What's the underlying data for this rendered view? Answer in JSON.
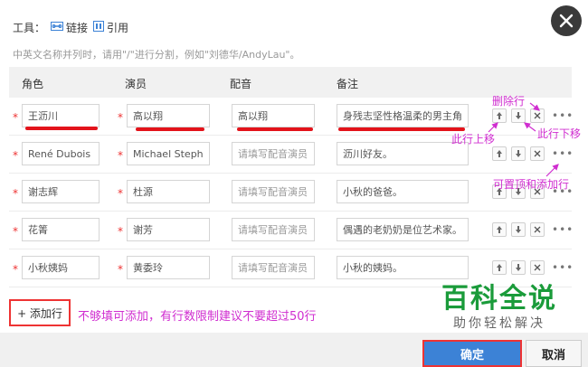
{
  "toolbar": {
    "label": "工具：",
    "link_label": "链接",
    "quote_label": "引用"
  },
  "hint": "中英文名称并列时，请用\"/\"进行分割，例如\"刘德华/AndyLau\"。",
  "table": {
    "headers": [
      "角色",
      "演员",
      "配音",
      "备注"
    ],
    "required_mark": "*",
    "rows": [
      {
        "role": "王沥川",
        "actor": "高以翔",
        "voice": "高以翔",
        "note": "身残志坚性格温柔的男主角。"
      },
      {
        "role": "René Dubois",
        "actor": "Michael Stephen",
        "voice": "",
        "note": "沥川好友。"
      },
      {
        "role": "谢志辉",
        "actor": "杜源",
        "voice": "",
        "note": "小秋的爸爸。"
      },
      {
        "role": "花箐",
        "actor": "谢芳",
        "voice": "",
        "note": "偶遇的老奶奶是位艺术家。"
      },
      {
        "role": "小秋姨妈",
        "actor": "黄委玲",
        "voice": "",
        "note": "小秋的姨妈。"
      }
    ],
    "voice_placeholder": "请填写配音演员"
  },
  "add_row_label": "+ 添加行",
  "annotations": {
    "delete_row": "删除行",
    "move_up": "此行上移",
    "move_down": "此行下移",
    "pin_add": "可置顶和添加行",
    "add_note": "不够填可添加，有行数限制建议不要超过50行"
  },
  "buttons": {
    "ok": "确定",
    "cancel": "取消"
  },
  "watermark": {
    "title": "百科全说",
    "subtitle": "助你轻松解决"
  },
  "colors": {
    "annotation": "#d02ed0",
    "highlight": "#e3131b",
    "primary": "#3c82d6",
    "watermark": "#1a9b3a"
  }
}
